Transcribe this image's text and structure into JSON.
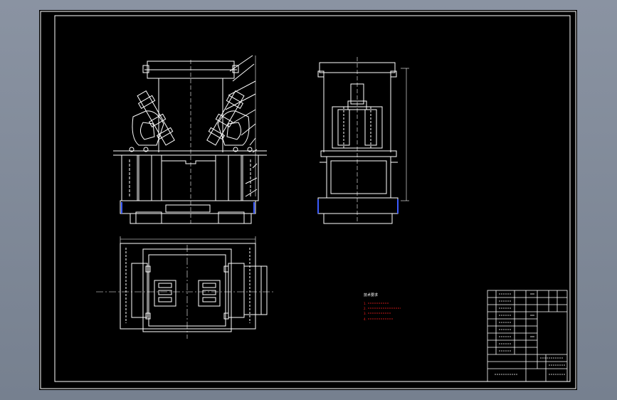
{
  "colors": {
    "background": "#7d8797",
    "sheet": "#000000",
    "line": "#ffffff",
    "annotation": "#ff2020",
    "accent_line": "#3b5bff"
  },
  "tech_notes": {
    "heading": "技术要求",
    "lines": [
      "1.",
      "2.",
      "3.",
      "4."
    ]
  }
}
